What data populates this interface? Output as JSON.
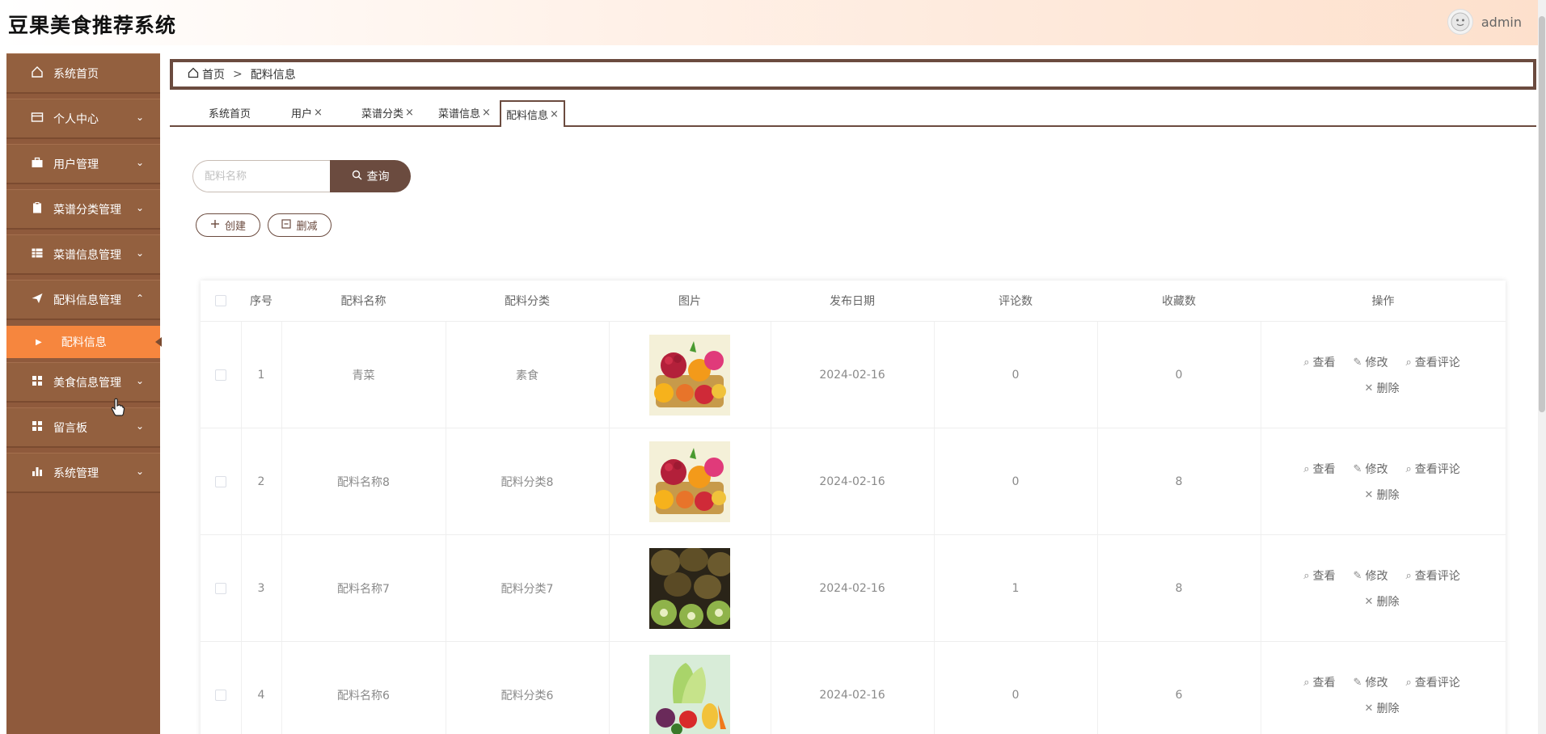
{
  "header": {
    "title": "豆果美食推荐系统",
    "user": "admin"
  },
  "sidebar": {
    "items": [
      {
        "label": "系统首页",
        "icon": "home-icon",
        "chevron": ""
      },
      {
        "label": "个人中心",
        "icon": "wallet-icon",
        "chevron": "⌄"
      },
      {
        "label": "用户管理",
        "icon": "briefcase-icon",
        "chevron": "⌄"
      },
      {
        "label": "菜谱分类管理",
        "icon": "clipboard-icon",
        "chevron": "⌄"
      },
      {
        "label": "菜谱信息管理",
        "icon": "grid-icon",
        "chevron": "⌄"
      },
      {
        "label": "配料信息管理",
        "icon": "send-icon",
        "chevron": "⌃"
      },
      {
        "label": "美食信息管理",
        "icon": "apps-icon",
        "chevron": "⌄"
      },
      {
        "label": "留言板",
        "icon": "apps-icon",
        "chevron": "⌄"
      },
      {
        "label": "系统管理",
        "icon": "chart-icon",
        "chevron": "⌄"
      }
    ],
    "sub_item": "配料信息"
  },
  "breadcrumb": {
    "home": "首页",
    "separator": ">",
    "current": "配料信息"
  },
  "tabs": [
    {
      "label": "系统首页",
      "close": ""
    },
    {
      "label": "用户",
      "close": "×"
    },
    {
      "label": "菜谱分类",
      "close": "×"
    },
    {
      "label": "菜谱信息",
      "close": "×"
    },
    {
      "label": "配料信息",
      "close": "×"
    }
  ],
  "search": {
    "placeholder": "配料名称",
    "button": "查询"
  },
  "actions": {
    "create": "创建",
    "delete": "删减"
  },
  "table": {
    "headers": [
      "序号",
      "配料名称",
      "配料分类",
      "图片",
      "发布日期",
      "评论数",
      "收藏数",
      "操作"
    ],
    "rows": [
      {
        "no": "1",
        "name": "青菜",
        "category": "素食",
        "image": "fruit-basket-image",
        "date": "2024-02-16",
        "comments": "0",
        "favorites": "0"
      },
      {
        "no": "2",
        "name": "配料名称8",
        "category": "配料分类8",
        "image": "fruit-basket-image",
        "date": "2024-02-16",
        "comments": "0",
        "favorites": "8"
      },
      {
        "no": "3",
        "name": "配料名称7",
        "category": "配料分类7",
        "image": "kiwi-image",
        "date": "2024-02-16",
        "comments": "1",
        "favorites": "8"
      },
      {
        "no": "4",
        "name": "配料名称6",
        "category": "配料分类6",
        "image": "vegetables-image",
        "date": "2024-02-16",
        "comments": "0",
        "favorites": "6"
      }
    ],
    "ops": {
      "view": "查看",
      "edit": "修改",
      "view_comments": "查看评论",
      "delete": "删除"
    }
  },
  "colors": {
    "sidebar": "#93603f",
    "active_sub": "#f6863e",
    "accent": "#6b4b3f"
  }
}
